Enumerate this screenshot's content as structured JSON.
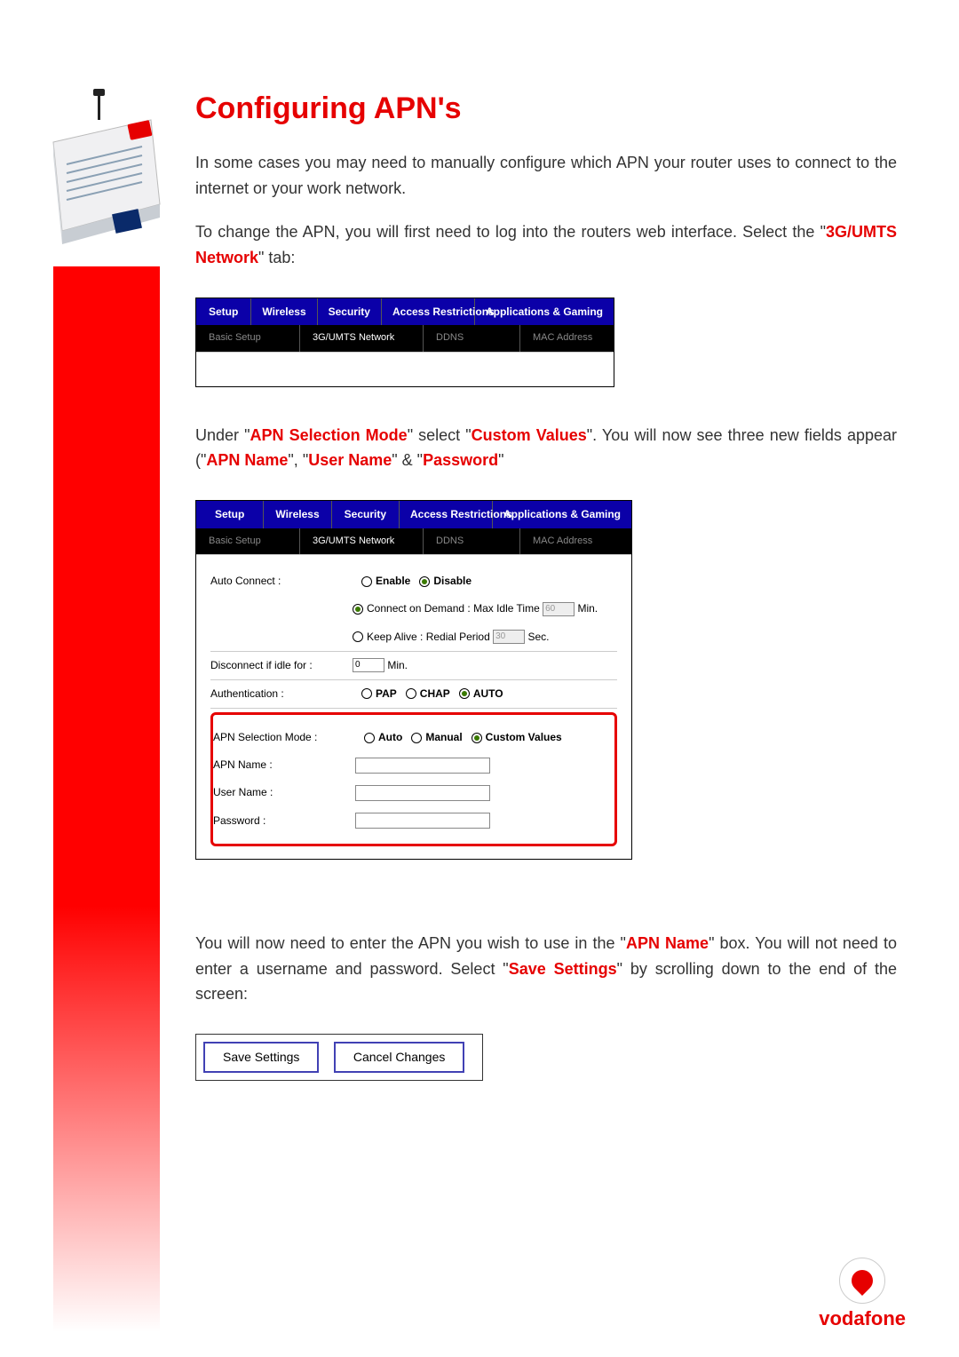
{
  "title": "Configuring APN's",
  "para1_a": "In some cases you may need to manually configure which APN your router uses to connect to the internet or your work network.",
  "para2_a": "To change the APN, you will first need to log into the routers web interface. Select the \"",
  "para2_red": "3G/UMTS Network",
  "para2_b": "\" tab:",
  "tabs": {
    "setup": "Setup",
    "wireless": "Wireless",
    "security": "Security",
    "access": "Access Restrictions",
    "apps": "Applications & Gaming",
    "sub_basic": "Basic Setup",
    "sub_3g": "3G/UMTS Network",
    "sub_ddns": "DDNS",
    "sub_mac": "MAC Address"
  },
  "para3_a": "Under \"",
  "para3_r1": "APN Selection Mode",
  "para3_b": "\" select \"",
  "para3_r2": "Custom Values",
  "para3_c": "\". You will now see three new fields appear (\"",
  "para3_r3": "APN Name",
  "para3_d": "\", \"",
  "para3_r4": "User Name",
  "para3_e": "\" & \"",
  "para3_r5": "Password",
  "para3_f": "\"",
  "form": {
    "auto_connect": "Auto Connect :",
    "enable": "Enable",
    "disable": "Disable",
    "connect_demand": "Connect on Demand : Max Idle Time",
    "idle_val": "60",
    "minutes": "Min.",
    "keep_alive": "Keep Alive : Redial Period",
    "redial_val": "30",
    "seconds": "Sec.",
    "disconnect": "Disconnect if idle for :",
    "disc_val": "0",
    "auth": "Authentication :",
    "pap": "PAP",
    "chap": "CHAP",
    "auto": "AUTO",
    "apn_mode": "APN Selection Mode :",
    "auto2": "Auto",
    "manual": "Manual",
    "custom": "Custom Values",
    "apn_name": "APN Name :",
    "user_name": "User Name :",
    "password": "Password :"
  },
  "para4_a": "You will now need to enter the APN you wish to use in the \"",
  "para4_r1": "APN Name",
  "para4_b": "\" box. You will not need to enter a username and password. Select \"",
  "para4_r2": "Save Settings",
  "para4_c": "\" by scrolling down to the end of the screen:",
  "save_settings": "Save Settings",
  "cancel_changes": "Cancel Changes",
  "brand": "vodafone"
}
